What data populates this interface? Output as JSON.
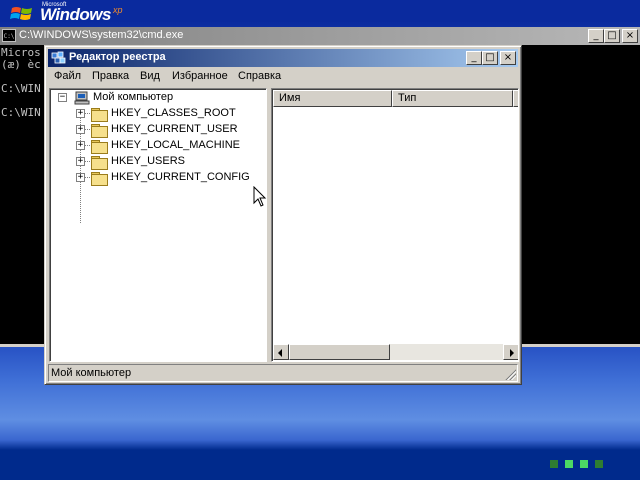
{
  "desktop": {
    "os_small_label": "Microsoft",
    "os_brand": "Windows",
    "os_version": "xp"
  },
  "cmd": {
    "title": "C:\\WINDOWS\\system32\\cmd.exe",
    "lines": [
      "Micros",
      "(æ) èc",
      "",
      "C:\\WIN",
      "",
      "C:\\WIN"
    ],
    "controls": {
      "minimize": "_",
      "maximize": "□",
      "close": "×"
    }
  },
  "regedit": {
    "title": "Редактор реестра",
    "controls": {
      "minimize": "_",
      "maximize": "□",
      "close": "×"
    },
    "menu": [
      "Файл",
      "Правка",
      "Вид",
      "Избранное",
      "Справка"
    ],
    "tree": {
      "root": {
        "label": "Мой компьютер",
        "toggle": "−"
      },
      "children": [
        {
          "label": "HKEY_CLASSES_ROOT",
          "toggle": "+"
        },
        {
          "label": "HKEY_CURRENT_USER",
          "toggle": "+"
        },
        {
          "label": "HKEY_LOCAL_MACHINE",
          "toggle": "+"
        },
        {
          "label": "HKEY_USERS",
          "toggle": "+"
        },
        {
          "label": "HKEY_CURRENT_CONFIG",
          "toggle": "+"
        }
      ]
    },
    "columns": [
      "Имя",
      "Тип",
      "З"
    ],
    "status": "Мой компьютер"
  },
  "colors": {
    "title_active_start": "#0a246a",
    "title_active_end": "#a6caf0",
    "title_inactive_start": "#808080",
    "face": "#d4d0c8",
    "desktop_blue": "#2a55c6"
  },
  "icons": {
    "cmd": "console-icon",
    "regedit": "registry-editor-icon",
    "computer": "computer-icon",
    "folder": "folder-icon"
  }
}
